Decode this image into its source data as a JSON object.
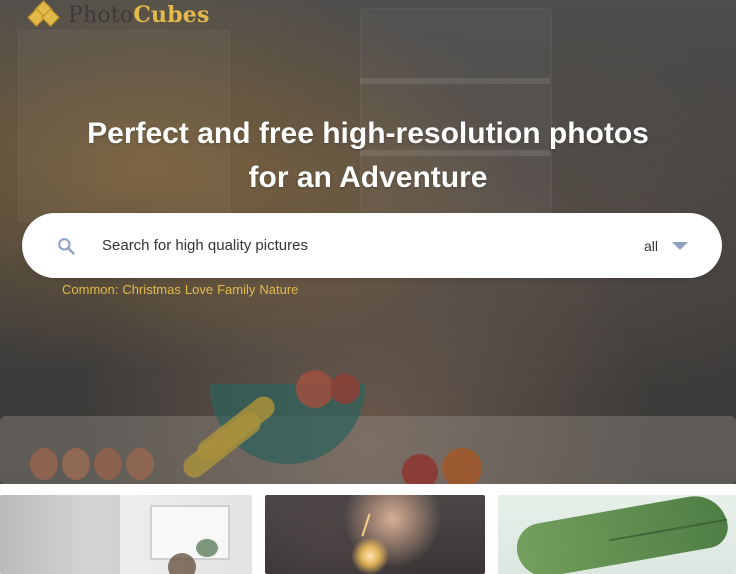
{
  "app": {
    "logo": {
      "brand_part_1": "Photo",
      "brand_part_2": "Cubes"
    }
  },
  "hero": {
    "title_line_1": "Perfect and free high-resolution photos",
    "title_line_2": "for an Adventure",
    "search": {
      "placeholder": "Search for high quality pictures",
      "type_selected": "all"
    },
    "common_tags": {
      "label": "Common:",
      "items": [
        "Christmas",
        "Love",
        "Family",
        "Nature"
      ]
    }
  },
  "thumbnails": [
    {
      "name": "thumbnail-1"
    },
    {
      "name": "thumbnail-2"
    },
    {
      "name": "thumbnail-3"
    }
  ],
  "colors": {
    "brand_gold": "#e2b94a",
    "brand_dark": "#3b3b3b",
    "search_bg": "#ffffff",
    "chevron": "#8fa2bf"
  }
}
